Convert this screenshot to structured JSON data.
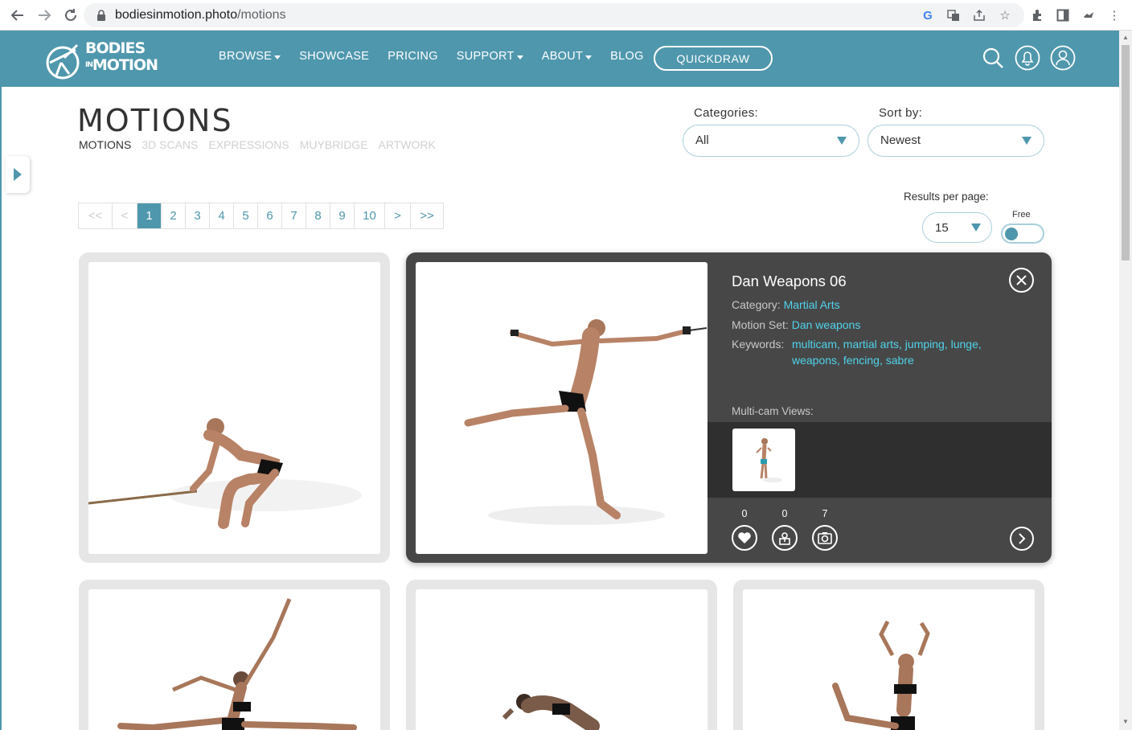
{
  "browser": {
    "url_domain": "bodiesinmotion.photo",
    "url_path": "/motions"
  },
  "logo": {
    "line1": "BODIES",
    "line2": "IN",
    "line3": "MOTION"
  },
  "nav": {
    "items": [
      "BROWSE",
      "SHOWCASE",
      "PRICING",
      "SUPPORT",
      "ABOUT",
      "BLOG"
    ],
    "quickdraw": "QUICKDRAW"
  },
  "page": {
    "title": "MOTIONS",
    "subtabs": [
      "MOTIONS",
      "3D SCANS",
      "EXPRESSIONS",
      "MUYBRIDGE",
      "ARTWORK"
    ]
  },
  "filters": {
    "categories_label": "Categories:",
    "categories_value": "All",
    "sort_label": "Sort by:",
    "sort_value": "Newest",
    "results_label": "Results per page:",
    "results_value": "15",
    "free_label": "Free"
  },
  "pager": [
    "<<",
    "<",
    "1",
    "2",
    "3",
    "4",
    "5",
    "6",
    "7",
    "8",
    "9",
    "10",
    ">",
    ">>"
  ],
  "detail": {
    "title": "Dan Weapons 06",
    "category_label": "Category:",
    "category_value": "Martial Arts",
    "motion_set_label": "Motion Set:",
    "motion_set_value": "Dan weapons",
    "keywords_label": "Keywords:",
    "keywords_value": "multicam, martial arts, jumping, lunge, weapons, fencing, sabre",
    "multicam_label": "Multi-cam Views:",
    "likes": "0",
    "downloads": "0",
    "photos": "7"
  }
}
